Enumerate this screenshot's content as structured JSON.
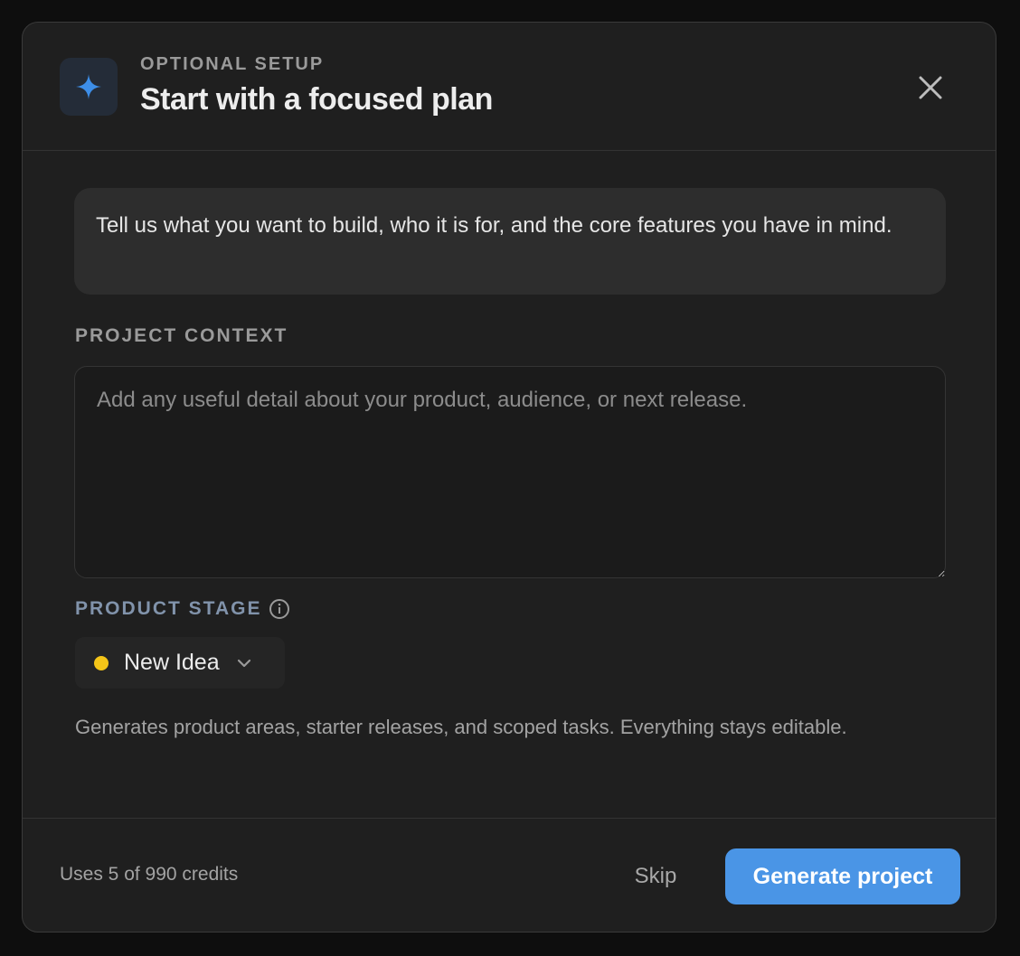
{
  "modal": {
    "eyebrow": "OPTIONAL SETUP",
    "title": "Start with a focused plan",
    "header_icon": "sparkle-icon",
    "close_icon": "close-icon"
  },
  "intro": {
    "text": "Tell us what you want to build, who it is for, and the core features you have in mind."
  },
  "context": {
    "label": "PROJECT CONTEXT",
    "placeholder": "Add any useful detail about your product, audience, or next release.",
    "value": ""
  },
  "stage": {
    "label": "PRODUCT STAGE",
    "info_icon": "info-icon",
    "selected": "New Idea",
    "status_color": "#f5c518",
    "chevron_icon": "chevron-down-icon"
  },
  "helper": {
    "text": "Generates product areas, starter releases, and scoped tasks. Everything stays editable."
  },
  "footer": {
    "credits": "Uses 5 of 990 credits",
    "skip_label": "Skip",
    "generate_label": "Generate project"
  },
  "colors": {
    "accent": "#4a95e6",
    "surface": "#1f1f1f",
    "stage_label": "#8193ab"
  }
}
